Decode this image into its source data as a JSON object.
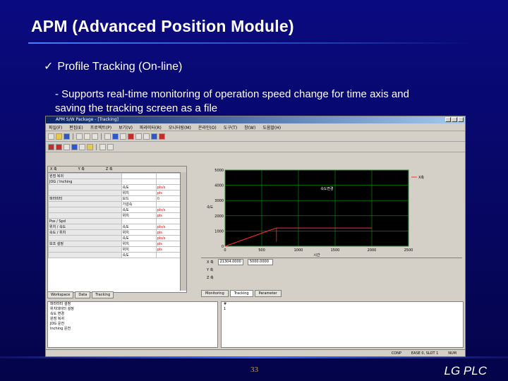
{
  "slide": {
    "title": "APM (Advanced Position  Module)",
    "bullet_check": "✓",
    "bullet": "Profile Tracking (On-line)",
    "sub_line1": "- Supports real-time monitoring of operation speed change for time axis and",
    "sub_line2": "saving the tracking screen as a file",
    "page_number": "33",
    "brand": "LG  PLC"
  },
  "app": {
    "window_title": "APM S/W Package - [Tracking]",
    "menu": [
      "파일(F)",
      "편집(E)",
      "프로젝트(P)",
      "보기(V)",
      "파라미터(R)",
      "모니터링(M)",
      "온라인(O)",
      "도구(T)",
      "창(W)",
      "도움말(H)"
    ],
    "left_panel_header": [
      "X 축",
      "Y 축",
      "Z 축"
    ],
    "param_rows": [
      {
        "label": "원점 복귀",
        "unit": "",
        "value": ""
      },
      {
        "label": "JOG / Inching",
        "unit": "",
        "value": ""
      },
      {
        "label": "",
        "unit": "속도",
        "value": "pls/s"
      },
      {
        "label": "",
        "unit": "위치",
        "value": "pls"
      },
      {
        "label": "파라미터",
        "unit": "모드",
        "value": "0"
      },
      {
        "label": "",
        "unit": "가감속",
        "value": ""
      },
      {
        "label": "",
        "unit": "속도",
        "value": "pls/s"
      },
      {
        "label": "",
        "unit": "위치",
        "value": "pls"
      },
      {
        "label": "Pos / Spd",
        "unit": "",
        "value": ""
      },
      {
        "label": "위치 / 속도",
        "unit": "속도",
        "value": "pls/s"
      },
      {
        "label": "속도 / 위치",
        "unit": "위치",
        "value": "pls"
      },
      {
        "label": "",
        "unit": "속도",
        "value": "pls/s"
      },
      {
        "label": "보조 설정",
        "unit": "위치",
        "value": "pls"
      },
      {
        "label": "",
        "unit": "위치",
        "value": "pls"
      },
      {
        "label": "",
        "unit": "속도",
        "value": ""
      }
    ],
    "left_tabs": [
      "Workspace",
      "Data",
      "Tracking"
    ],
    "chart_legend": "X축",
    "chart_annotation": "속도변경",
    "chart_ylabel": "속도",
    "chart_xlabel": "시간",
    "ctrl_labels": {
      "row1": "X 축",
      "row2": "Y 축",
      "row3": "Z 축"
    },
    "ctrl_values": {
      "pos": "21304.0000",
      "max": "5000.0000"
    },
    "right_tabs": [
      "Monitoring",
      "Tracking",
      "Parameter"
    ],
    "messages_left": [
      "파라미터 설정",
      "위치데이터 설정",
      "속도 변경",
      "원점 복귀",
      "JOG 운전",
      "Inching 운전"
    ],
    "messages_right": [
      "#",
      "1"
    ],
    "status": [
      "CONP",
      "EASE 0, SLOT 1",
      "NUM"
    ]
  },
  "chart_data": {
    "type": "line",
    "series": [
      {
        "name": "X축",
        "x": [
          0,
          700,
          750,
          1500,
          2000
        ],
        "y": [
          0,
          1200,
          1200,
          1200,
          1200
        ]
      }
    ],
    "xlim": [
      0,
      2500
    ],
    "ylim": [
      0,
      5000
    ],
    "xticks": [
      0,
      500,
      1000,
      1500,
      2000,
      2500
    ],
    "yticks": [
      0,
      1000,
      2000,
      3000,
      4000,
      5000
    ],
    "xlabel": "시간",
    "ylabel": "속도",
    "grid": true,
    "legend": "top-right"
  }
}
